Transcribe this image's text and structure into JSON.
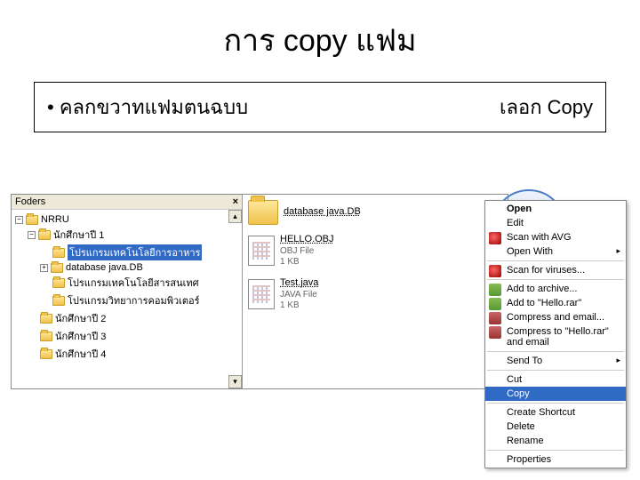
{
  "slide": {
    "title": "การ copy แฟม",
    "bullet": "คลกขวาทแฟมตนฉบบ",
    "hint": "เลอก  Copy"
  },
  "folders": {
    "header": "Foders",
    "close": "×",
    "tree": [
      {
        "level": 0,
        "toggle": "−",
        "label": "NRRU"
      },
      {
        "level": 1,
        "toggle": "−",
        "label": "นักศึกษาปี 1"
      },
      {
        "level": 2,
        "toggle": "",
        "label": "โปรแกรมเทคโนโลยีการอาหาร",
        "selected": true
      },
      {
        "level": 2,
        "toggle": "+",
        "label": "database java.DB"
      },
      {
        "level": 2,
        "toggle": "",
        "label": "โปรแกรมเทคโนโลยีสารสนเทศ"
      },
      {
        "level": 2,
        "toggle": "",
        "label": "โปรแกรมวิทยาการคอมพิวเตอร์"
      },
      {
        "level": 1,
        "toggle": "",
        "label": "นักศึกษาปี 2"
      },
      {
        "level": 1,
        "toggle": "",
        "label": "นักศึกษาปี 3"
      },
      {
        "level": 1,
        "toggle": "",
        "label": "นักศึกษาปี 4"
      }
    ]
  },
  "files": [
    {
      "type": "folder",
      "name": "database java.DB",
      "sub1": "",
      "sub2": ""
    },
    {
      "type": "file",
      "name": "HELLO.OBJ",
      "sub1": "OBJ File",
      "sub2": "1 KB"
    },
    {
      "type": "file",
      "name": "Test.java",
      "sub1": "JAVA File",
      "sub2": "1 KB"
    }
  ],
  "menu": {
    "open": "Open",
    "edit": "Edit",
    "scan_avg": "Scan with AVG",
    "open_with": "Open With",
    "scan_virus": "Scan for viruses...",
    "add_archive": "Add to archive...",
    "add_hello": "Add to \"Hello.rar\"",
    "compress_email": "Compress and email...",
    "compress_hello": "Compress to \"Hello.rar\" and email",
    "send_to": "Send To",
    "cut": "Cut",
    "copy": "Copy",
    "create_shortcut": "Create Shortcut",
    "delete": "Delete",
    "rename": "Rename",
    "properties": "Properties"
  }
}
